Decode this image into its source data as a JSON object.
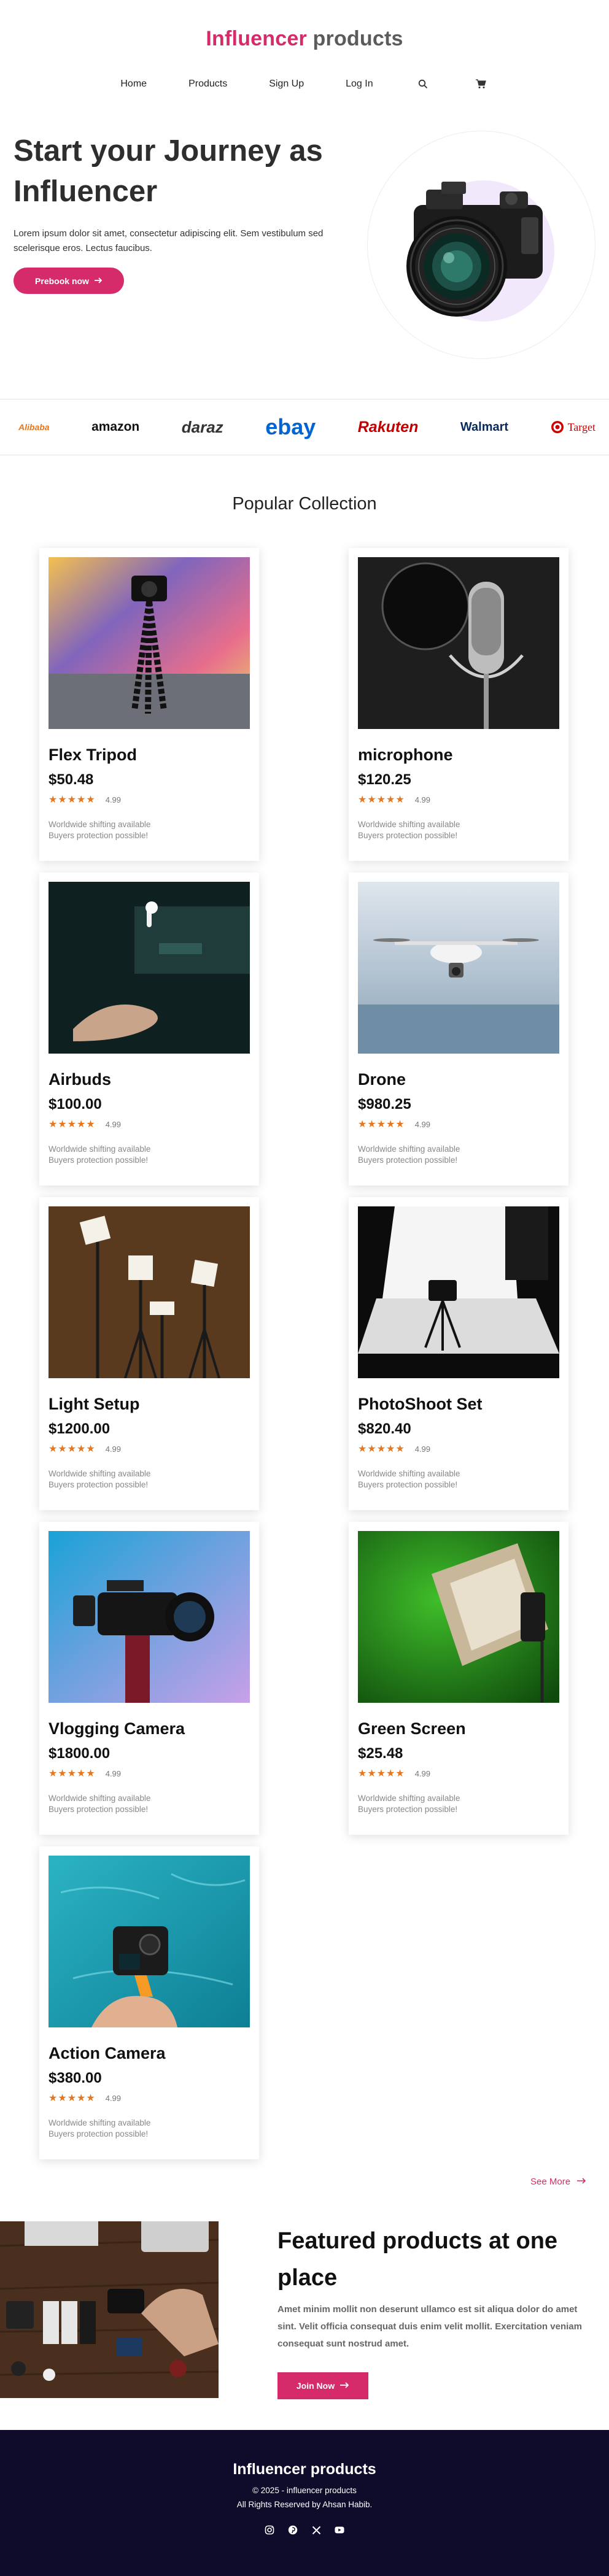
{
  "header": {
    "brand_accent": "Influencer",
    "brand_rest": "products",
    "nav": [
      "Home",
      "Products",
      "Sign Up",
      "Log In"
    ],
    "icons": [
      "search-icon",
      "cart-icon"
    ]
  },
  "hero": {
    "title": "Start your Journey as Influencer",
    "text": "Lorem ipsum dolor sit amet, consectetur adipiscing elit. Sem vestibulum sed scelerisque eros. Lectus faucibus.",
    "button": "Prebook now"
  },
  "brands": [
    "Alibaba",
    "amazon",
    "daraz",
    "ebay",
    "Rakuten",
    "Walmart",
    "Target"
  ],
  "collection": {
    "title": "Popular Collection",
    "shipping_line1": "Worldwide shifting available",
    "shipping_line2": "Buyers protection possible!",
    "products": [
      {
        "name": "Flex Tripod",
        "price": "$50.48",
        "rating": "4.99"
      },
      {
        "name": "microphone",
        "price": "$120.25",
        "rating": "4.99"
      },
      {
        "name": "Airbuds",
        "price": "$100.00",
        "rating": "4.99"
      },
      {
        "name": "Drone",
        "price": "$980.25",
        "rating": "4.99"
      },
      {
        "name": "Light Setup",
        "price": "$1200.00",
        "rating": "4.99"
      },
      {
        "name": "PhotoShoot Set",
        "price": "$820.40",
        "rating": "4.99"
      },
      {
        "name": "Vlogging Camera",
        "price": "$1800.00",
        "rating": "4.99"
      },
      {
        "name": "Green Screen",
        "price": "$25.48",
        "rating": "4.99"
      },
      {
        "name": "Action Camera",
        "price": "$380.00",
        "rating": "4.99"
      }
    ],
    "see_more": "See More"
  },
  "featured": {
    "title": "Featured products at one place",
    "text": "Amet minim mollit non deserunt ullamco est sit aliqua dolor do amet sint. Velit officia consequat duis enim velit mollit. Exercitation veniam consequat sunt nostrud amet.",
    "button": "Join Now"
  },
  "footer": {
    "title": "Influencer products",
    "copyright": "© 2025 - influencer products",
    "rights": "All Rights Reserved by Ahsan Habib.",
    "socials": [
      "instagram-icon",
      "pinterest-icon",
      "x-icon",
      "youtube-icon"
    ]
  },
  "colors": {
    "accent": "#d62b6a",
    "footer_bg": "#0e0b2b",
    "star": "#e8761c"
  }
}
